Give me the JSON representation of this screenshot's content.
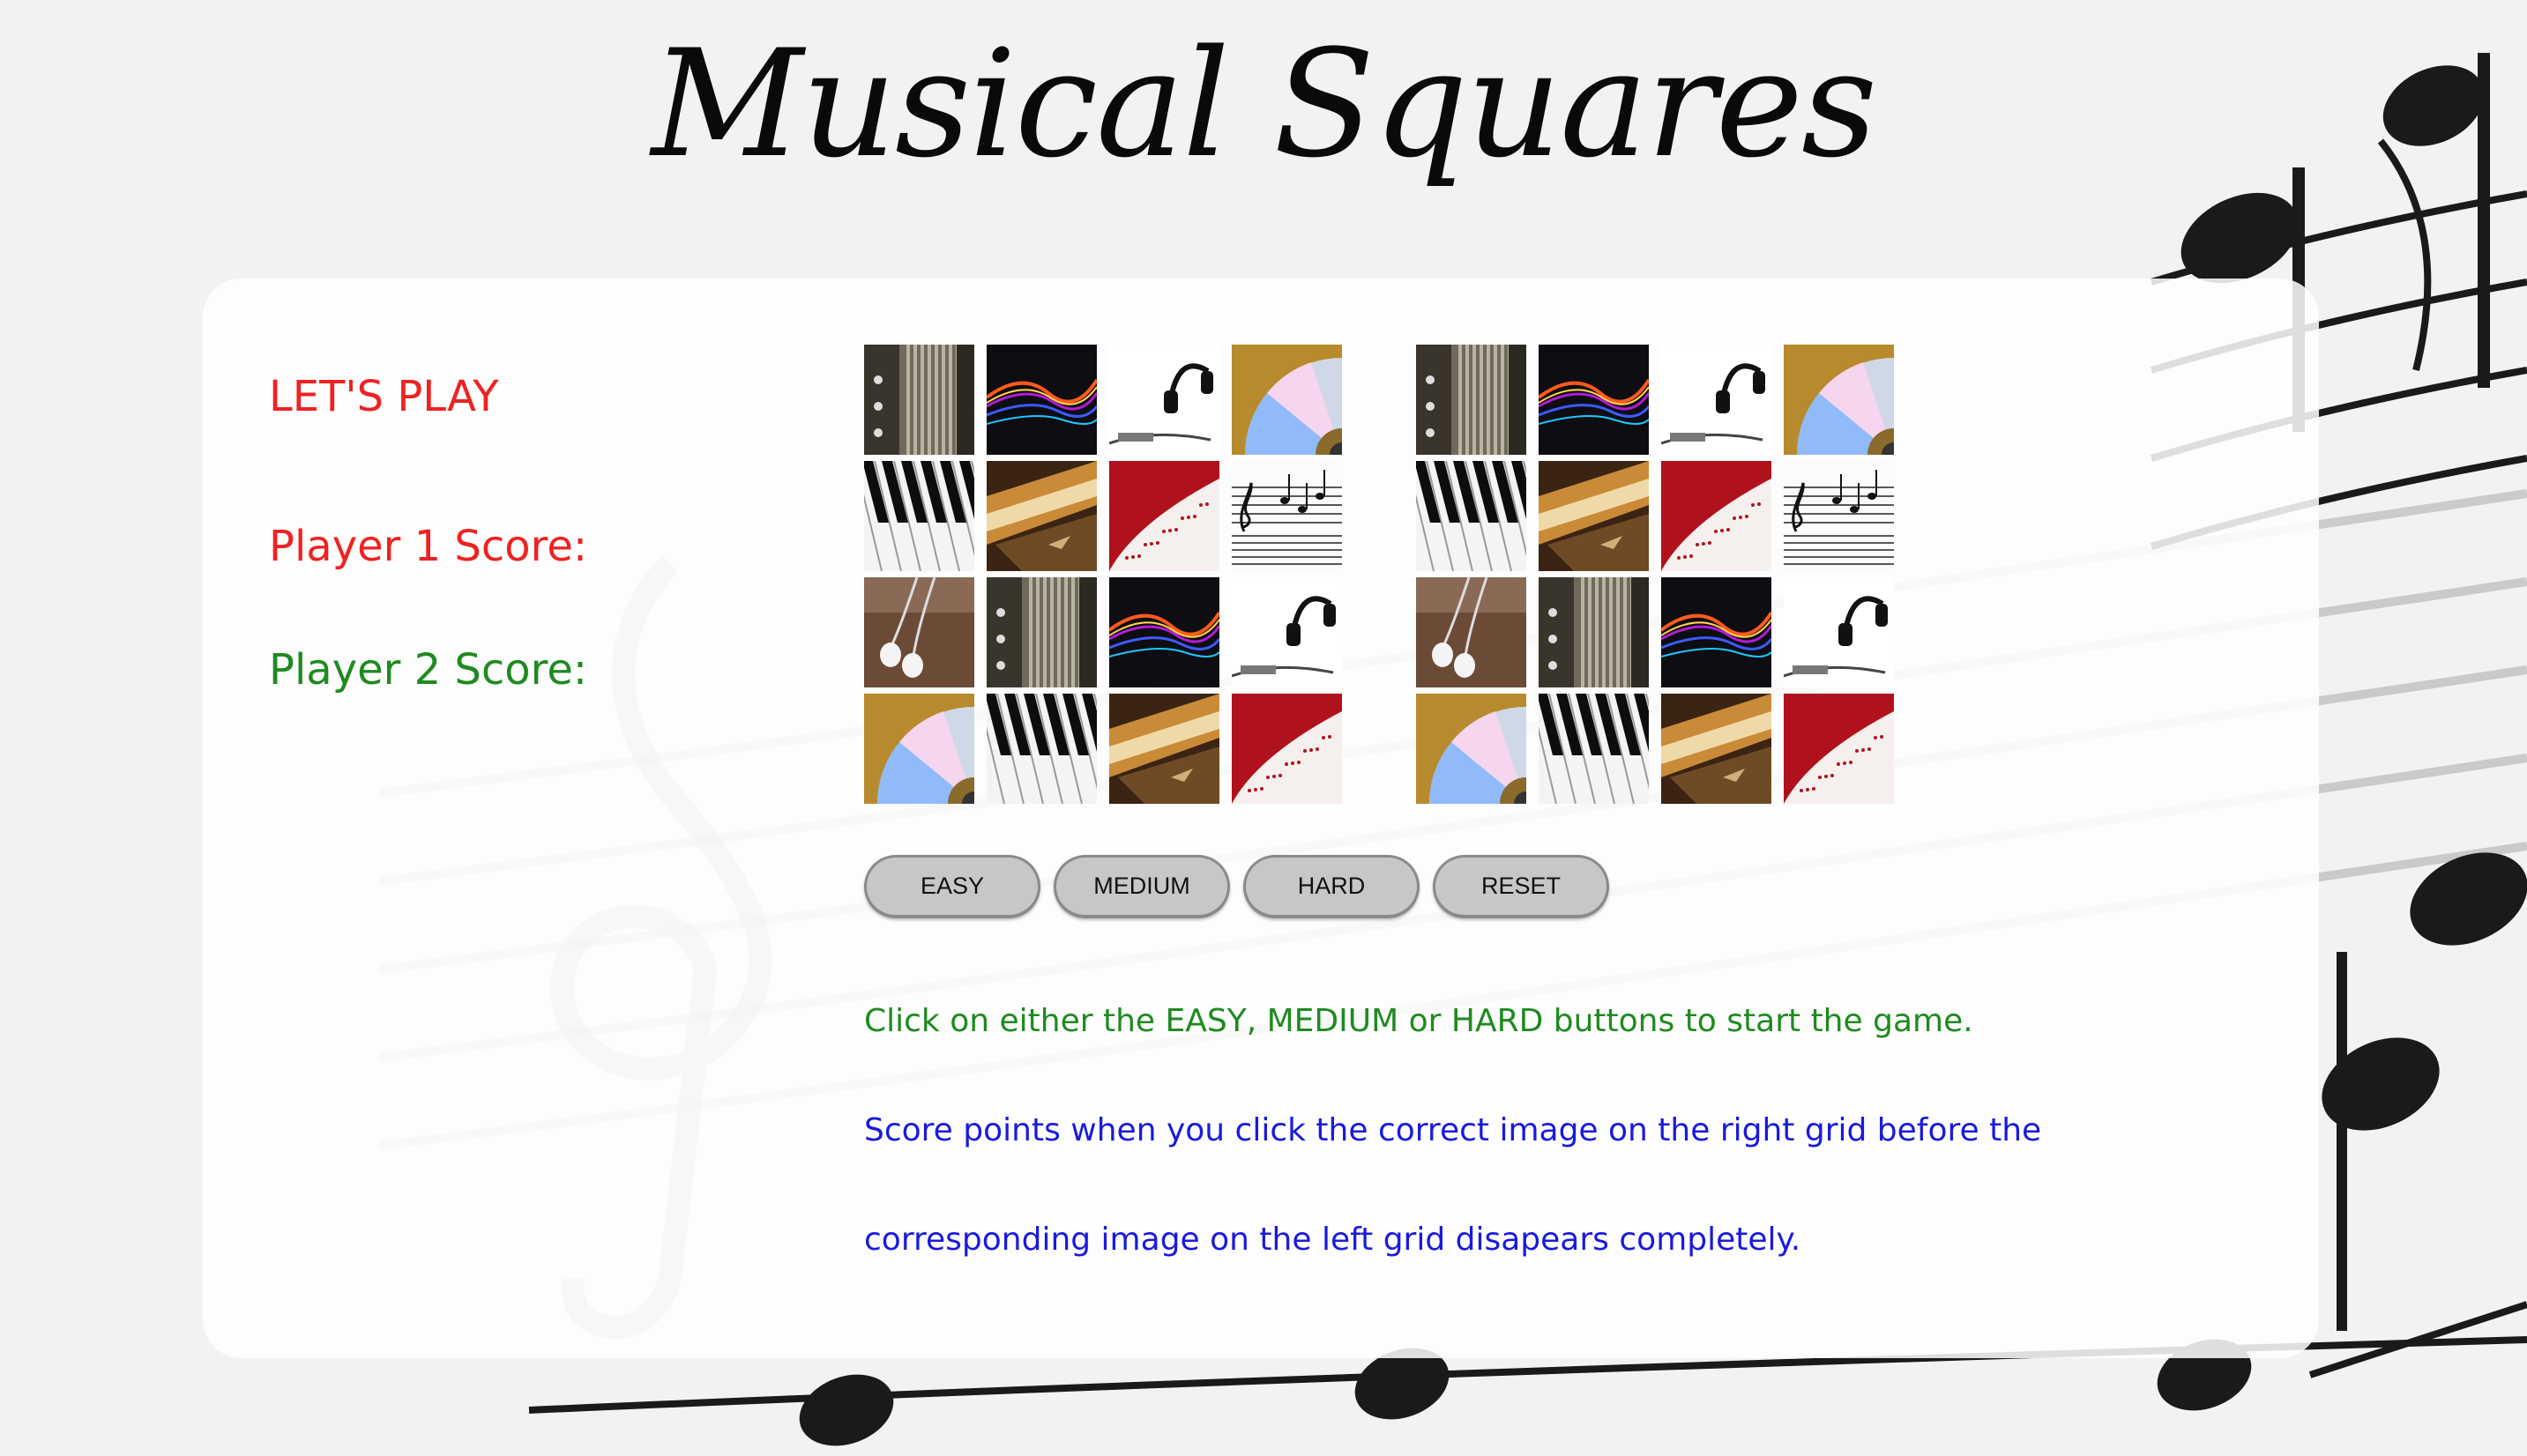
{
  "page": {
    "title": "Musical Squares"
  },
  "sidebar": {
    "lets_play": "LET'S PLAY",
    "player1_label": "Player 1 Score:",
    "player2_label": "Player 2 Score:"
  },
  "grids": {
    "left": [
      "accordion",
      "light-streaks",
      "headphones",
      "cd",
      "piano-keys",
      "harmonica",
      "red-score",
      "sheet-music",
      "earphones",
      "accordion",
      "light-streaks",
      "headphones",
      "cd",
      "piano-keys",
      "harmonica",
      "red-score"
    ],
    "right": [
      "accordion",
      "light-streaks",
      "headphones",
      "cd",
      "piano-keys",
      "harmonica",
      "red-score",
      "sheet-music",
      "earphones",
      "accordion",
      "light-streaks",
      "headphones",
      "cd",
      "piano-keys",
      "harmonica",
      "red-score"
    ]
  },
  "buttons": {
    "easy": "EASY",
    "medium": "MEDIUM",
    "hard": "HARD",
    "reset": "RESET"
  },
  "instructions": {
    "line1": "Click on either the EASY, MEDIUM or HARD buttons to start the game.",
    "line2": "Score points when you click the correct image on the right grid before the",
    "line3": "corresponding image on the left grid disapears completely."
  },
  "colors": {
    "lets_play": "#ee2222",
    "player1": "#ee2222",
    "player2": "#1f8a1f",
    "instr_green": "#1f8a1f",
    "instr_blue": "#1a1add"
  }
}
